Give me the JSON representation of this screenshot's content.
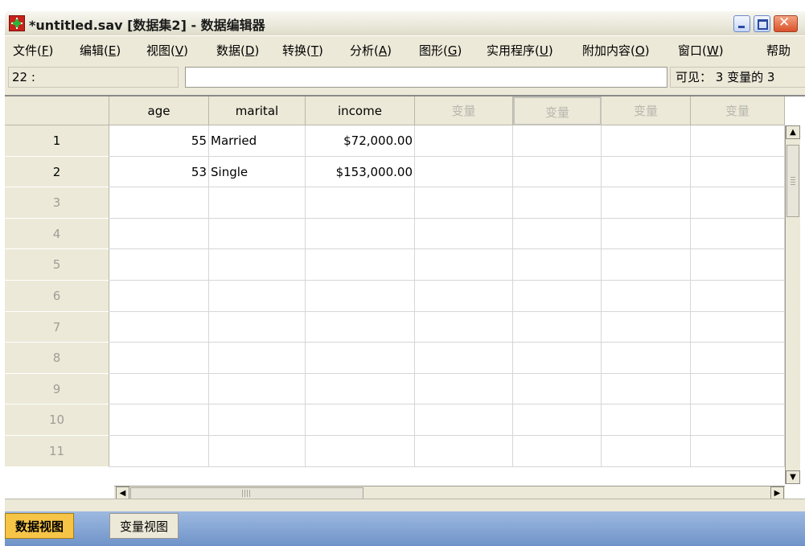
{
  "window": {
    "title": "*untitled.sav [数据集2] - 数据编辑器"
  },
  "menu": [
    {
      "label": "文件",
      "key": "F"
    },
    {
      "label": "编辑",
      "key": "E"
    },
    {
      "label": "视图",
      "key": "V"
    },
    {
      "label": "数据",
      "key": "D"
    },
    {
      "label": "转换",
      "key": "T"
    },
    {
      "label": "分析",
      "key": "A"
    },
    {
      "label": "图形",
      "key": "G"
    },
    {
      "label": "实用程序",
      "key": "U"
    },
    {
      "label": "附加内容",
      "key": "O"
    },
    {
      "label": "窗口",
      "key": "W"
    },
    {
      "label": "帮助",
      "key": ""
    }
  ],
  "editor": {
    "cell_ref": "22 :",
    "cell_value": "",
    "visible_info": "可见： 3 变量的 3"
  },
  "grid": {
    "columns": [
      "age",
      "marital",
      "income",
      "变量",
      "变量",
      "变量",
      "变量"
    ],
    "row_numbers": [
      "1",
      "2",
      "3",
      "4",
      "5",
      "6",
      "7",
      "8",
      "9",
      "10",
      "11"
    ],
    "rows": [
      {
        "age": "55",
        "marital": "Married",
        "income": "$72,000.00"
      },
      {
        "age": "53",
        "marital": "Single",
        "income": "$153,000.00"
      }
    ]
  },
  "tabs": {
    "data_view": "数据视图",
    "variable_view": "变量视图"
  },
  "colors": {
    "window_bg": "#ece9d8",
    "active_tab": "#f6c447",
    "tabbar": "#7fa1d4",
    "placeholder_header": "#b8b7ae"
  }
}
